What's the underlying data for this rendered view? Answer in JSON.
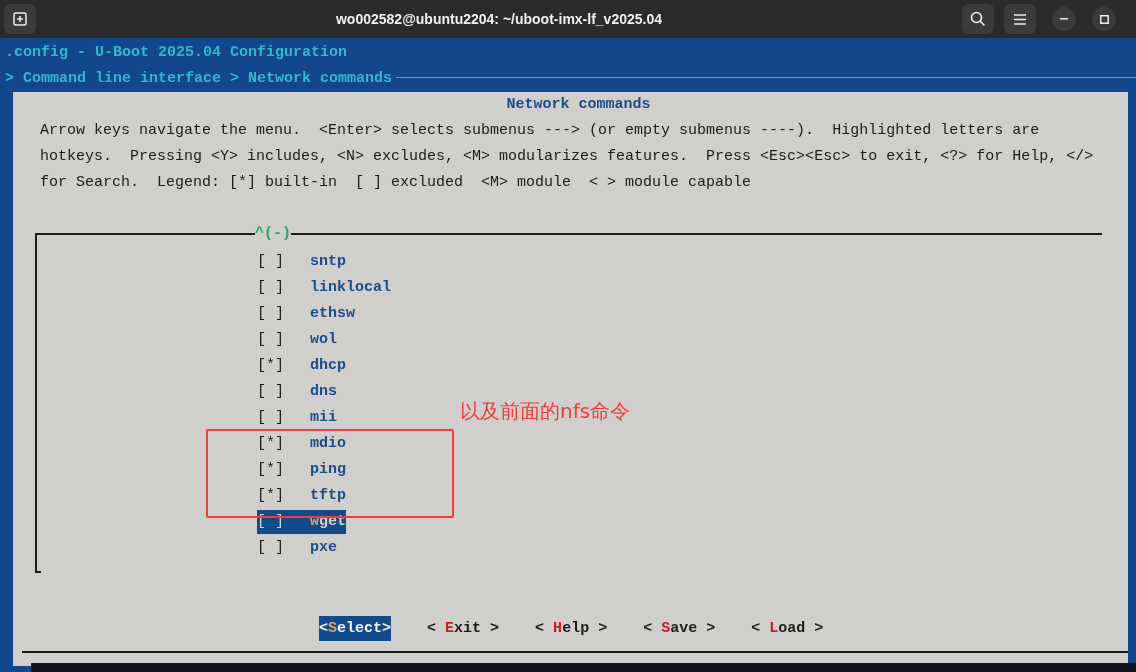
{
  "window": {
    "title": "wo002582@ubuntu2204: ~/uboot-imx-lf_v2025.04"
  },
  "terminal": {
    "header": ".config - U-Boot 2025.04 Configuration",
    "breadcrumb": "> Command line interface > Network commands"
  },
  "dialog": {
    "title": "Network commands",
    "help_lines": [
      "Arrow keys navigate the menu.  <Enter> selects submenus ---> (or empty submenus ----).  Highlighted letters are",
      "hotkeys.  Pressing <Y> includes, <N> excludes, <M> modularizes features.  Press <Esc><Esc> to exit, <?> for Help, </>",
      "for Search.  Legend: [*] built-in  [ ] excluded  <M> module  < > module capable"
    ],
    "scroll_indicator": "^(-)",
    "items": [
      {
        "box": "[ ]",
        "hotkey": "s",
        "rest": "ntp",
        "selected": false
      },
      {
        "box": "[ ]",
        "hotkey": "l",
        "rest": "inklocal",
        "selected": false
      },
      {
        "box": "[ ]",
        "hotkey": "e",
        "rest": "thsw",
        "selected": false
      },
      {
        "box": "[ ]",
        "hotkey": "w",
        "rest": "ol",
        "selected": false
      },
      {
        "box": "[*]",
        "hotkey": "d",
        "rest": "hcp",
        "selected": false
      },
      {
        "box": "[ ]",
        "hotkey": "d",
        "rest": "ns",
        "selected": false
      },
      {
        "box": "[ ]",
        "hotkey": "m",
        "rest": "ii",
        "selected": false
      },
      {
        "box": "[*]",
        "hotkey": "m",
        "rest": "dio",
        "selected": false
      },
      {
        "box": "[*]",
        "hotkey": "p",
        "rest": "ing",
        "selected": false
      },
      {
        "box": "[*]",
        "hotkey": "t",
        "rest": "ftp",
        "selected": false
      },
      {
        "box": "[ ]",
        "hotkey": "w",
        "rest": "get",
        "selected": true
      },
      {
        "box": "[ ]",
        "hotkey": "p",
        "rest": "xe",
        "selected": false
      }
    ],
    "buttons": [
      {
        "before": "<",
        "hotkey": "S",
        "after": "elect>",
        "selected": true
      },
      {
        "before": "< ",
        "hotkey": "E",
        "after": "xit >",
        "selected": false
      },
      {
        "before": "< ",
        "hotkey": "H",
        "after": "elp >",
        "selected": false
      },
      {
        "before": "< ",
        "hotkey": "S",
        "after": "ave >",
        "selected": false
      },
      {
        "before": "< ",
        "hotkey": "L",
        "after": "oad >",
        "selected": false
      }
    ]
  },
  "annotation": {
    "text": "以及前面的nfs命令"
  }
}
